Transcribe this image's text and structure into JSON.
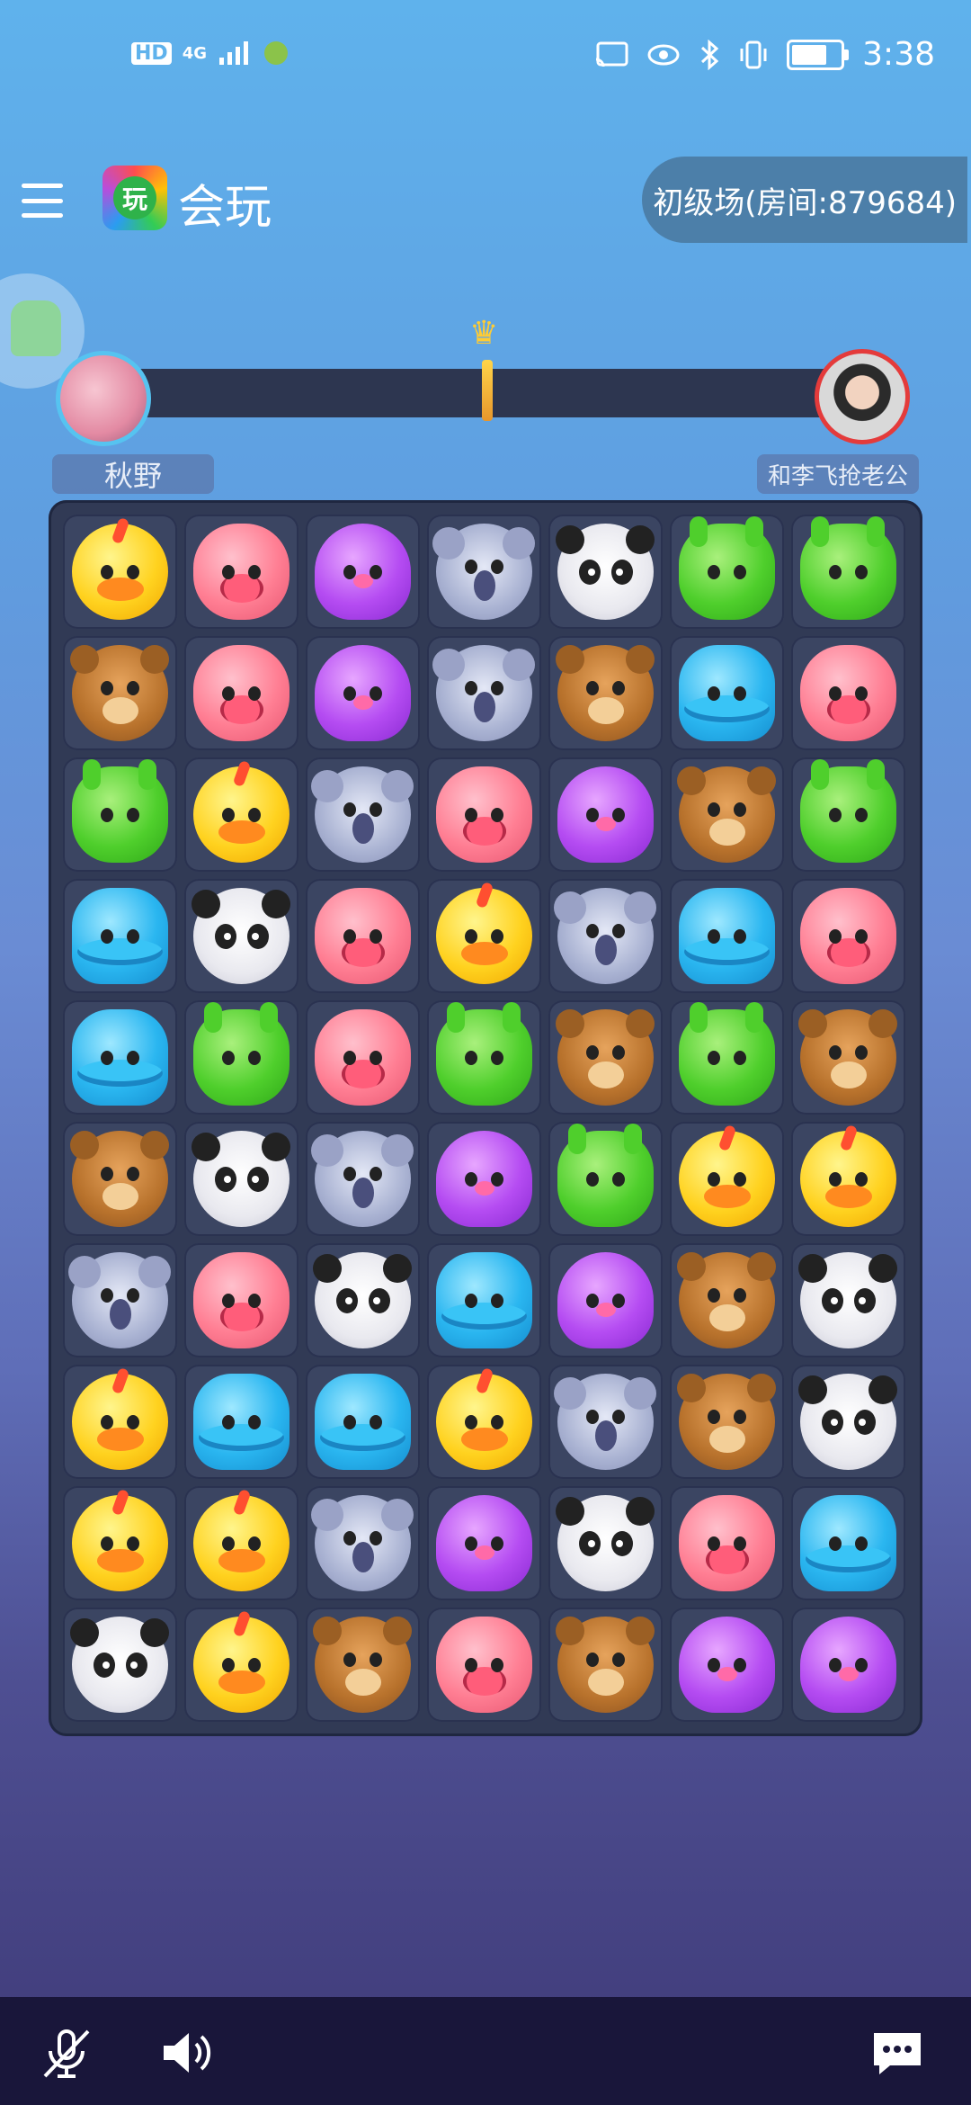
{
  "status_bar": {
    "left_icons": [
      "hd-icon",
      "4g-icon",
      "signal-icon",
      "app-notification-icon"
    ],
    "time": "3:38",
    "hd": "HD",
    "network": "4G"
  },
  "header": {
    "app_name": "会玩",
    "logo_glyph": "玩",
    "room_label": "初级场(房间:879684)"
  },
  "players": {
    "left": {
      "name": "秋野"
    },
    "right": {
      "name": "和李飞抢老公"
    }
  },
  "progress": {
    "left_share": 0.5
  },
  "board": {
    "rows": [
      [
        "chick",
        "pig",
        "octopus",
        "koala",
        "panda",
        "frog",
        "frog"
      ],
      [
        "bear",
        "pig",
        "octopus",
        "koala",
        "bear",
        "hippo",
        "pig"
      ],
      [
        "frog",
        "chick",
        "koala",
        "pig",
        "octopus",
        "bear",
        "frog"
      ],
      [
        "hippo",
        "panda",
        "pig",
        "chick",
        "koala",
        "hippo",
        "pig"
      ],
      [
        "hippo",
        "frog",
        "pig",
        "frog",
        "bear",
        "frog",
        "bear"
      ],
      [
        "bear",
        "panda",
        "koala",
        "octopus",
        "frog",
        "chick",
        "chick"
      ],
      [
        "koala",
        "pig",
        "panda",
        "hippo",
        "octopus",
        "bear",
        "panda"
      ],
      [
        "chick",
        "hippo",
        "hippo",
        "chick",
        "koala",
        "bear",
        "panda"
      ],
      [
        "chick",
        "chick",
        "koala",
        "octopus",
        "panda",
        "pig",
        "hippo"
      ],
      [
        "panda",
        "chick",
        "bear",
        "pig",
        "bear",
        "octopus",
        "octopus"
      ]
    ]
  },
  "bottom_bar": {
    "icons": [
      "mic-muted-icon",
      "speaker-icon",
      "chat-icon"
    ]
  }
}
